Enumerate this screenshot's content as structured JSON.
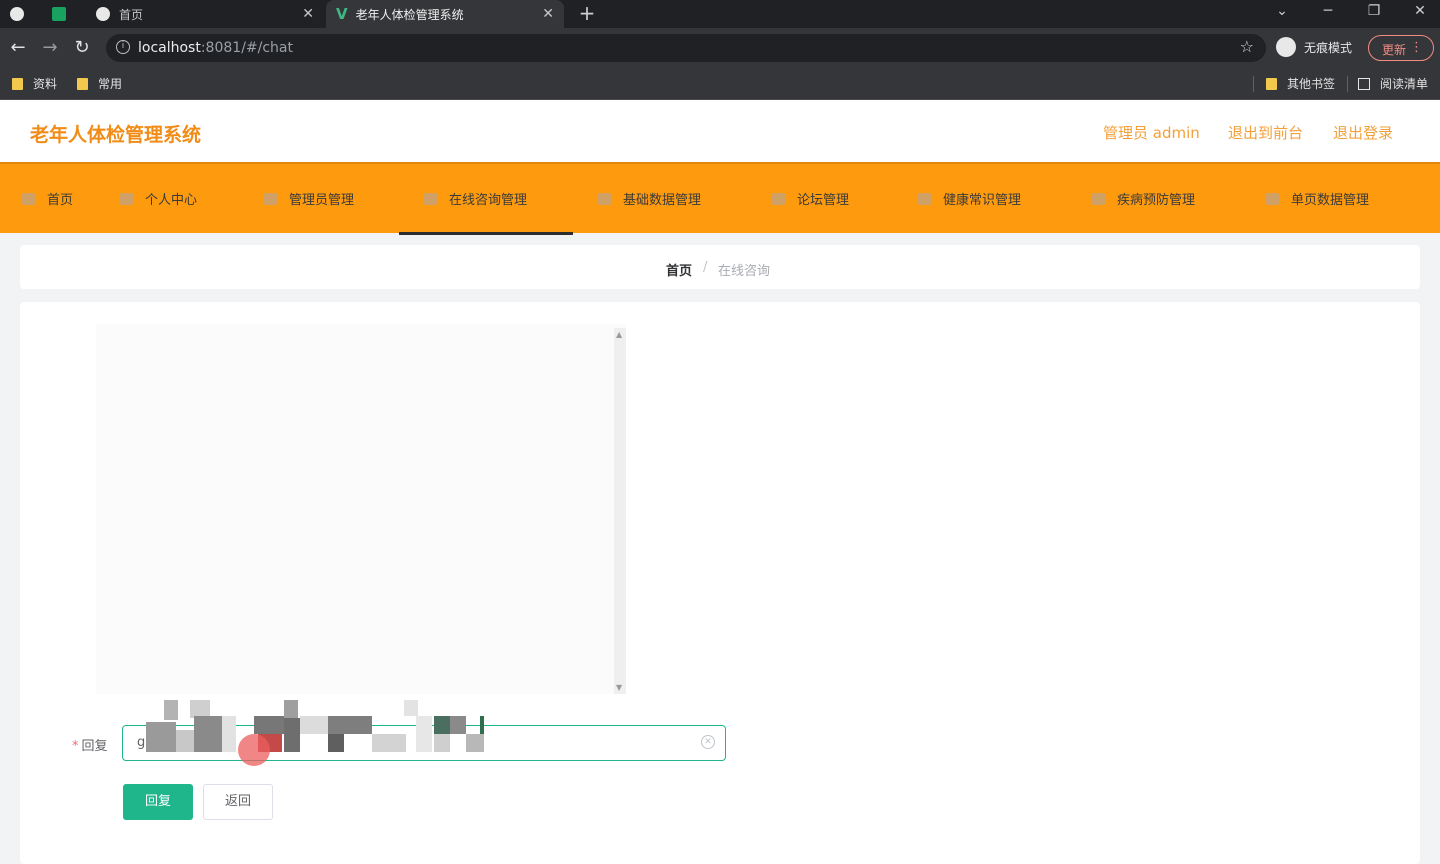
{
  "browser": {
    "tabs": [
      {
        "label": "首页",
        "active": false
      },
      {
        "label": "老年人体检管理系统",
        "active": true
      }
    ],
    "url_host": "localhost",
    "url_rest": ":8081/#/chat",
    "incognito_label": "无痕模式",
    "update_label": "更新",
    "bookmarks": [
      "资料",
      "常用"
    ],
    "bookmarks_right": [
      "其他书签",
      "阅读清单"
    ]
  },
  "header": {
    "title": "老年人体检管理系统",
    "links": [
      "管理员 admin",
      "退出到前台",
      "退出登录"
    ]
  },
  "menu": {
    "items": [
      "首页",
      "个人中心",
      "管理员管理",
      "在线咨询管理",
      "基础数据管理",
      "论坛管理",
      "健康常识管理",
      "疾病预防管理",
      "单页数据管理"
    ],
    "active": "在线咨询管理"
  },
  "breadcrumb": {
    "home": "首页",
    "separator": "/",
    "current": "在线咨询"
  },
  "form": {
    "required_mark": "*",
    "reply_label": "回复",
    "reply_value": "g",
    "reply_button": "回复",
    "back_button": "返回"
  },
  "colors": {
    "brand_orange": "#fd9a0e",
    "title_orange": "#f08c17",
    "primary_green": "#1fb68b"
  }
}
